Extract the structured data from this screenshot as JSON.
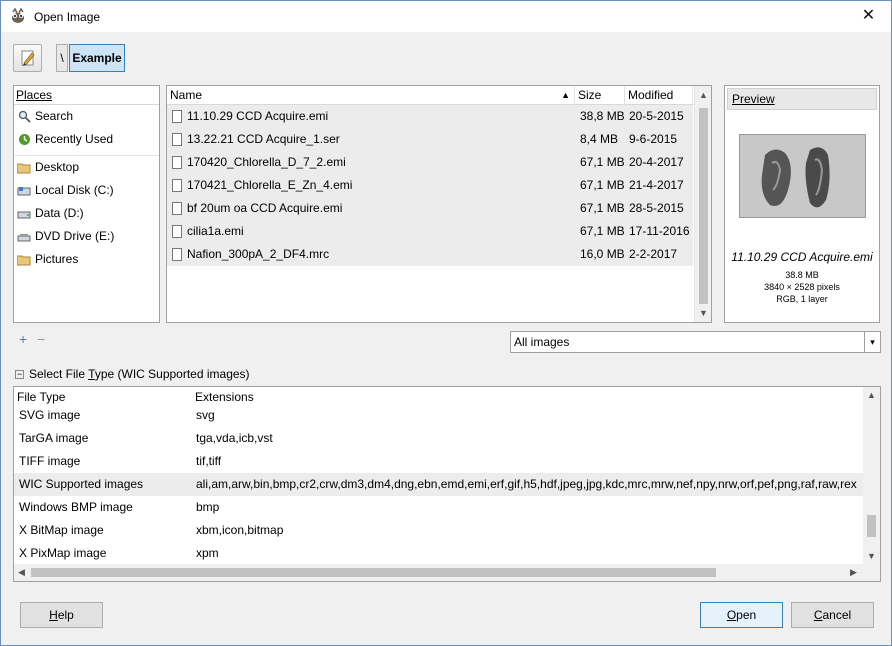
{
  "window": {
    "title": "Open Image",
    "close_glyph": "✕"
  },
  "path_bar": {
    "separator": "\\",
    "current": "Example"
  },
  "places": {
    "header": "Places",
    "items": [
      {
        "label": "Search",
        "icon": "search-icon"
      },
      {
        "label": "Recently Used",
        "icon": "recent-icon"
      },
      {
        "label": "Desktop",
        "icon": "folder-icon"
      },
      {
        "label": "Local Disk (C:)",
        "icon": "drive-icon"
      },
      {
        "label": "Data (D:)",
        "icon": "drive-icon"
      },
      {
        "label": "DVD Drive (E:)",
        "icon": "dvd-icon"
      },
      {
        "label": "Pictures",
        "icon": "folder-icon"
      }
    ],
    "add_glyph": "+",
    "remove_glyph": "−"
  },
  "file_list": {
    "columns": {
      "name": "Name",
      "size": "Size",
      "modified": "Modified",
      "sort_arrow": "▲"
    },
    "rows": [
      {
        "name": "11.10.29 CCD Acquire.emi",
        "size": "38,8 MB",
        "modified": "20-5-2015"
      },
      {
        "name": "13.22.21 CCD Acquire_1.ser",
        "size": "8,4 MB",
        "modified": "9-6-2015"
      },
      {
        "name": "170420_Chlorella_D_7_2.emi",
        "size": "67,1 MB",
        "modified": "20-4-2017"
      },
      {
        "name": "170421_Chlorella_E_Zn_4.emi",
        "size": "67,1 MB",
        "modified": "21-4-2017"
      },
      {
        "name": "bf 20um oa CCD Acquire.emi",
        "size": "67,1 MB",
        "modified": "28-5-2015"
      },
      {
        "name": "cilia1a.emi",
        "size": "67,1 MB",
        "modified": "17-11-2016"
      },
      {
        "name": "Nafion_300pA_2_DF4.mrc",
        "size": "16,0 MB",
        "modified": "2-2-2017"
      }
    ]
  },
  "preview": {
    "title": "Preview",
    "filename": "11.10.29 CCD Acquire.emi",
    "size": "38.8 MB",
    "dimensions": "3840 × 2528 pixels",
    "mode": "RGB, 1 layer"
  },
  "filter": {
    "value": "All images",
    "arrow": "▾"
  },
  "file_type": {
    "expander_glyph": "−",
    "label_prefix": "Select File ",
    "label_accel": "T",
    "label_suffix": "ype (WIC Supported images)",
    "columns": {
      "type": "File Type",
      "extensions": "Extensions"
    },
    "rows": [
      {
        "type": "SVG image",
        "extensions": "svg"
      },
      {
        "type": "TarGA image",
        "extensions": "tga,vda,icb,vst"
      },
      {
        "type": "TIFF image",
        "extensions": "tif,tiff"
      },
      {
        "type": "WIC Supported images",
        "extensions": "ali,am,arw,bin,bmp,cr2,crw,dm3,dm4,dng,ebn,emd,emi,erf,gif,h5,hdf,jpeg,jpg,kdc,mrc,mrw,nef,npy,nrw,orf,pef,png,raf,raw,rex",
        "selected": true
      },
      {
        "type": "Windows BMP image",
        "extensions": "bmp"
      },
      {
        "type": "X BitMap image",
        "extensions": "xbm,icon,bitmap"
      },
      {
        "type": "X PixMap image",
        "extensions": "xpm"
      }
    ]
  },
  "buttons": {
    "help": {
      "accel": "H",
      "rest": "elp"
    },
    "open": {
      "accel": "O",
      "rest": "pen"
    },
    "cancel": {
      "accel": "C",
      "rest": "ancel"
    }
  }
}
